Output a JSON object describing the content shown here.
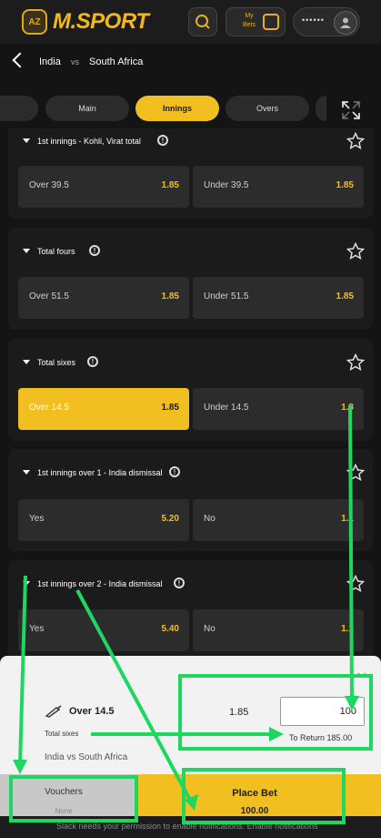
{
  "header": {
    "brand": "M.SPORT",
    "brand_badge": "AZ",
    "my_bets": "My Bets",
    "account_masked": "••••••"
  },
  "match": {
    "team1": "India",
    "vs": "vs",
    "team2": "South Africa"
  },
  "tabs": [
    {
      "label": ""
    },
    {
      "label": "Main"
    },
    {
      "label": "Innings",
      "active": true
    },
    {
      "label": "Overs"
    }
  ],
  "markets": [
    {
      "title": "1st innings - Kohli, Virat total",
      "options": [
        {
          "label": "Over 39.5",
          "price": "1.85"
        },
        {
          "label": "Under 39.5",
          "price": "1.85"
        }
      ]
    },
    {
      "title": "Total fours",
      "options": [
        {
          "label": "Over 51.5",
          "price": "1.85"
        },
        {
          "label": "Under 51.5",
          "price": "1.85"
        }
      ]
    },
    {
      "title": "Total sixes",
      "options": [
        {
          "label": "Over 14.5",
          "price": "1.85",
          "selected": true
        },
        {
          "label": "Under 14.5",
          "price": "1.8"
        }
      ]
    },
    {
      "title": "1st innings over 1 - India dismissal",
      "options": [
        {
          "label": "Yes",
          "price": "5.20"
        },
        {
          "label": "No",
          "price": "1.1"
        }
      ]
    },
    {
      "title": "1st innings over 2 - India dismissal",
      "options": [
        {
          "label": "Yes",
          "price": "5.40"
        },
        {
          "label": "No",
          "price": "1.1"
        }
      ]
    }
  ],
  "betslip": {
    "selection": "Over 14.5",
    "market": "Total sixes",
    "match": "India vs South Africa",
    "odds": "1.85",
    "stake": "100",
    "to_return_label": "To Return",
    "to_return": "185.00",
    "vouchers_label": "Vouchers",
    "vouchers_value": "None",
    "place_bet_label": "Place Bet",
    "place_bet_amount": "100.00"
  },
  "notification": "Slack needs your permission to enable notifications. Enable notifications",
  "colors": {
    "accent": "#f2bf20",
    "annotation": "#1ed760"
  }
}
